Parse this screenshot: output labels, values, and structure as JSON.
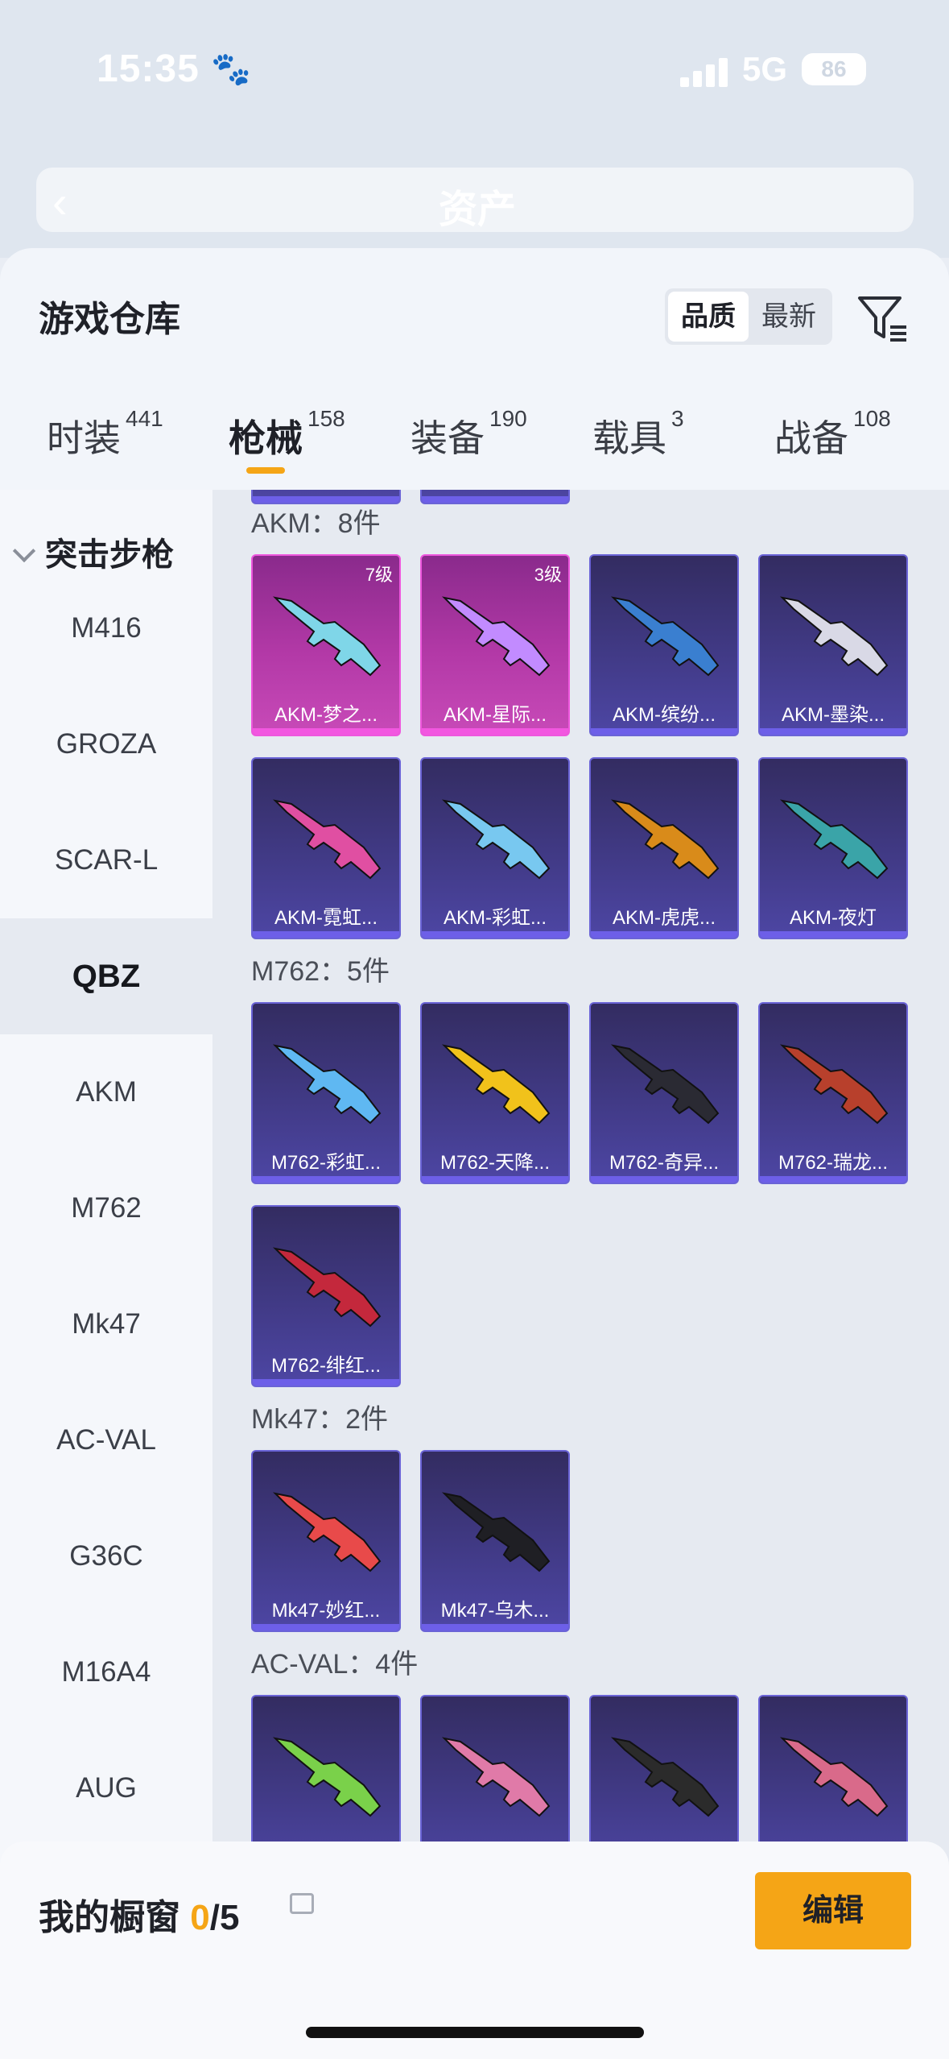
{
  "status": {
    "time": "15:35",
    "network": "5G",
    "battery": "86"
  },
  "page": {
    "title": "资产"
  },
  "sheet": {
    "title": "游戏仓库",
    "sort": [
      "品质",
      "最新"
    ]
  },
  "tabs": [
    {
      "label": "时装",
      "count": "441"
    },
    {
      "label": "枪械",
      "count": "158"
    },
    {
      "label": "装备",
      "count": "190"
    },
    {
      "label": "载具",
      "count": "3"
    },
    {
      "label": "战备",
      "count": "108"
    }
  ],
  "sidebar": {
    "header": "突击步枪",
    "items": [
      "M416",
      "GROZA",
      "SCAR-L",
      "QBZ",
      "AKM",
      "M762",
      "Mk47",
      "AC-VAL",
      "G36C",
      "M16A4",
      "AUG"
    ]
  },
  "groups": [
    {
      "title": "AKM：8件",
      "items": [
        {
          "name": "AKM-梦之...",
          "level": "7级",
          "rarity": "pink"
        },
        {
          "name": "AKM-星际...",
          "level": "3级",
          "rarity": "pink"
        },
        {
          "name": "AKM-缤纷...",
          "level": "",
          "rarity": "purple"
        },
        {
          "name": "AKM-墨染...",
          "level": "",
          "rarity": "purple"
        },
        {
          "name": "AKM-霓虹...",
          "level": "",
          "rarity": "purple"
        },
        {
          "name": "AKM-彩虹...",
          "level": "",
          "rarity": "purple"
        },
        {
          "name": "AKM-虎虎...",
          "level": "",
          "rarity": "purple"
        },
        {
          "name": "AKM-夜灯",
          "level": "",
          "rarity": "purple"
        }
      ]
    },
    {
      "title": "M762：5件",
      "items": [
        {
          "name": "M762-彩虹...",
          "level": "",
          "rarity": "purple"
        },
        {
          "name": "M762-天降...",
          "level": "",
          "rarity": "purple"
        },
        {
          "name": "M762-奇异...",
          "level": "",
          "rarity": "purple"
        },
        {
          "name": "M762-瑞龙...",
          "level": "",
          "rarity": "purple"
        },
        {
          "name": "M762-绯红...",
          "level": "",
          "rarity": "purple"
        }
      ]
    },
    {
      "title": "Mk47：2件",
      "items": [
        {
          "name": "Mk47-妙红...",
          "level": "",
          "rarity": "purple"
        },
        {
          "name": "Mk47-乌木...",
          "level": "",
          "rarity": "purple"
        }
      ]
    },
    {
      "title": "AC-VAL：4件",
      "items": [
        {
          "name": "",
          "level": "",
          "rarity": "purple"
        },
        {
          "name": "",
          "level": "",
          "rarity": "purple"
        },
        {
          "name": "",
          "level": "",
          "rarity": "purple"
        },
        {
          "name": "",
          "level": "",
          "rarity": "purple"
        }
      ]
    }
  ],
  "showcase": {
    "label": "我的橱窗",
    "used": "0",
    "total": "/5",
    "edit_label": "编辑"
  },
  "icons": {
    "back": "chevron-left-icon",
    "filter": "filter-icon",
    "share": "share-out-icon",
    "lock": "lock-icon"
  },
  "colors": {
    "accent": "#f5a516",
    "pink_rarity": "#ee57dd",
    "purple_rarity": "#6a63d6"
  }
}
